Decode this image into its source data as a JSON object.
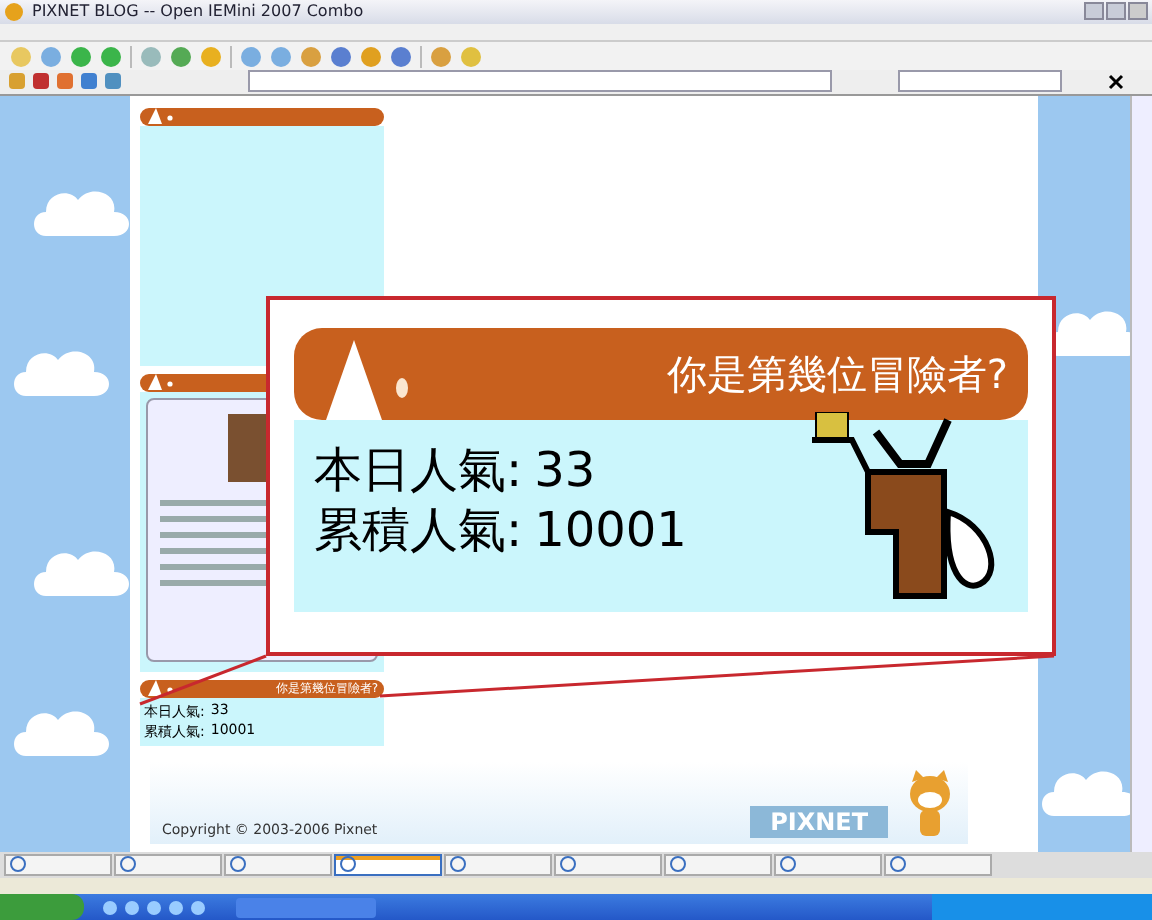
{
  "window": {
    "title": "PIXNET BLOG -- Open IEMini 2007 Combo"
  },
  "visitor_widget": {
    "title": "你是第幾位冒險者?",
    "counters": [
      {
        "label": "本日人氣:",
        "value": "33"
      },
      {
        "label": "累積人氣:",
        "value": "10001"
      }
    ]
  },
  "callout": {
    "title": "你是第幾位冒險者?",
    "counters": [
      {
        "label": "本日人氣:",
        "value": "33"
      },
      {
        "label": "累積人氣:",
        "value": "10001"
      }
    ]
  },
  "browser_tabs": [
    {
      "selected": false
    },
    {
      "selected": false
    },
    {
      "selected": false
    },
    {
      "selected": true
    },
    {
      "selected": false
    },
    {
      "selected": false
    },
    {
      "selected": false
    },
    {
      "selected": false
    },
    {
      "selected": false
    }
  ],
  "footer": {
    "copyright": "Copyright © 2003-2006 Pixnet",
    "logo": "PIXNET"
  }
}
